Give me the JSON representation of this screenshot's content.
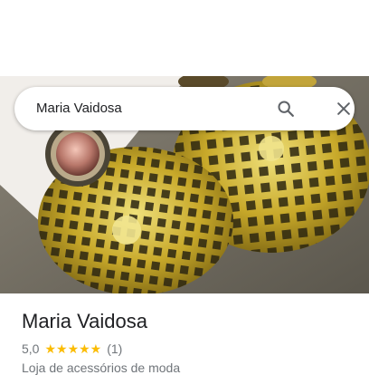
{
  "search": {
    "query": "Maria Vaidosa"
  },
  "place": {
    "name": "Maria Vaidosa",
    "rating": "5,0",
    "stars": "★★★★★",
    "review_count": "(1)",
    "category": "Loja de acessórios de moda"
  },
  "icons": {
    "search": "search-icon",
    "close": "close-icon"
  },
  "colors": {
    "star": "#fbbc04",
    "text_primary": "#202124",
    "text_secondary": "#70757a",
    "icon": "#5f6368"
  }
}
